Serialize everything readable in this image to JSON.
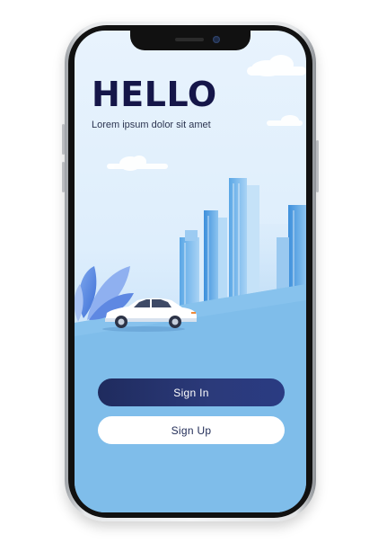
{
  "screen": {
    "title": "HELLO",
    "subtitle": "Lorem ipsum dolor sit amet"
  },
  "actions": {
    "sign_in_label": "Sign In",
    "sign_up_label": "Sign Up"
  },
  "colors": {
    "primary": "#1f2b5e",
    "sky_top": "#e8f3fd",
    "ground": "#7fbdea",
    "title_text": "#151649"
  }
}
